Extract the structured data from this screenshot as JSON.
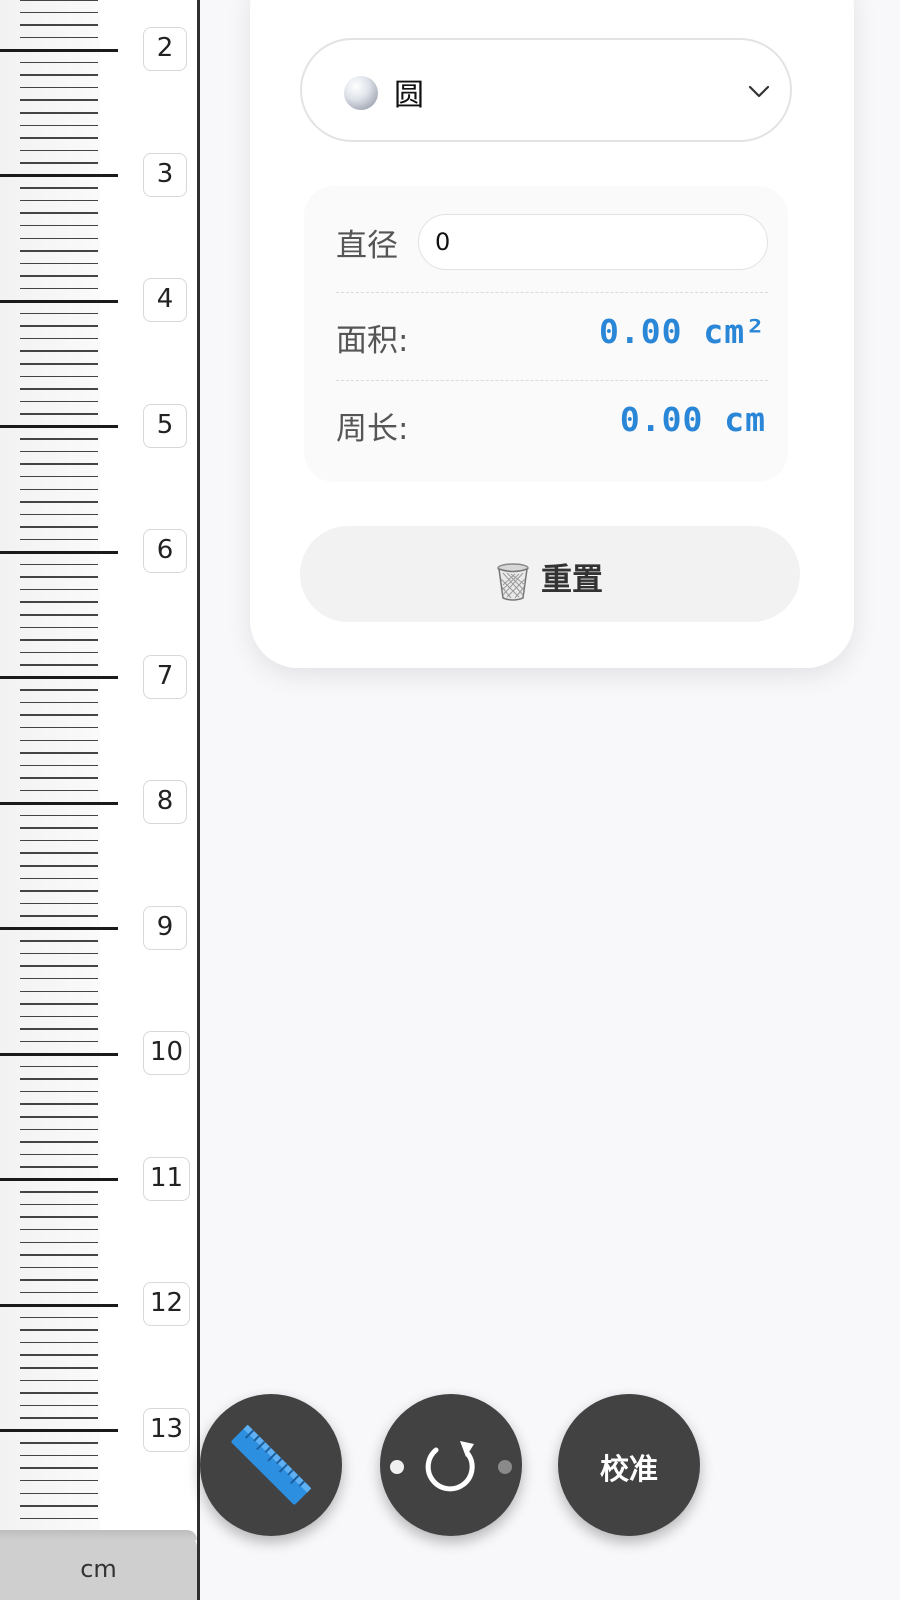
{
  "ruler": {
    "labels": [
      "2",
      "3",
      "4",
      "5",
      "6",
      "7",
      "8",
      "9",
      "10",
      "11",
      "12",
      "13"
    ],
    "unit": "cm"
  },
  "panel": {
    "shape_select": {
      "icon": "sphere-icon",
      "selected": "圆"
    },
    "diameter": {
      "label": "直径",
      "value": "0"
    },
    "area": {
      "label": "面积:",
      "value": "0.00 cm²"
    },
    "perimeter": {
      "label": "周长:",
      "value": "0.00 cm"
    },
    "reset": {
      "icon": "wastebasket-icon",
      "label": "重置"
    }
  },
  "fabs": {
    "ruler": {
      "icon": "ruler-icon"
    },
    "rotate": {
      "icon": "rotate-icon"
    },
    "calibrate": {
      "label": "校准"
    }
  },
  "colors": {
    "accent": "#2a86d6",
    "fab_bg": "#424242",
    "page_bg": "#f8f8fb"
  }
}
